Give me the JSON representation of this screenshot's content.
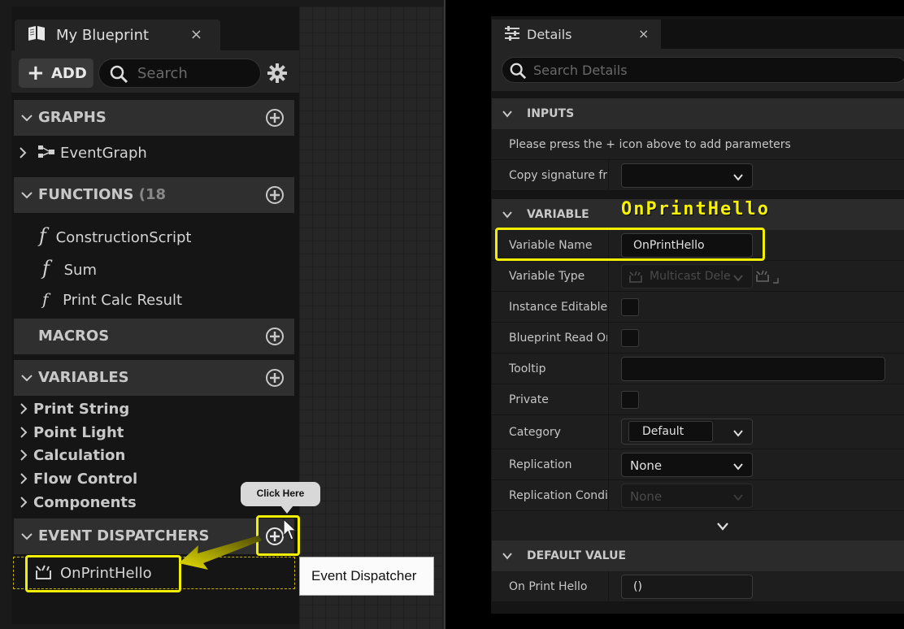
{
  "blueprint_panel": {
    "tab_title": "My Blueprint",
    "tab_close": "×",
    "add_label": "ADD",
    "search_placeholder": "Search",
    "sections": {
      "graphs": "GRAPHS",
      "functions": "FUNCTIONS",
      "functions_count": "(18",
      "macros": "MACROS",
      "variables": "VARIABLES",
      "event_dispatchers": "EVENT DISPATCHERS"
    },
    "graphs": [
      "EventGraph"
    ],
    "functions": [
      "ConstructionScript",
      "Sum",
      "Print Calc Result"
    ],
    "variable_categories": [
      "Print String",
      "Point Light",
      "Calculation",
      "Flow Control",
      "Components"
    ],
    "event_dispatchers": [
      "OnPrintHello"
    ],
    "tooltip_text": "Click Here",
    "callout_text": "Event Dispatcher"
  },
  "details_panel": {
    "tab_title": "Details",
    "tab_close": "×",
    "search_placeholder": "Search Details",
    "annotation": "OnPrintHello",
    "inputs": {
      "header": "INPUTS",
      "hint": "Please press the + icon above to add parameters",
      "copy_signature_label": "Copy signature fro"
    },
    "variable": {
      "header": "VARIABLE",
      "name_label": "Variable Name",
      "name_value": "OnPrintHello",
      "type_label": "Variable Type",
      "type_value": "Multicast Dele",
      "instance_editable_label": "Instance Editable",
      "bp_read_only_label": "Blueprint Read Onl",
      "tooltip_label": "Tooltip",
      "private_label": "Private",
      "category_label": "Category",
      "category_value": "Default",
      "replication_label": "Replication",
      "replication_value": "None",
      "replication_condition_label": "Replication Conditi",
      "replication_condition_value": "None"
    },
    "default_value": {
      "header": "DEFAULT VALUE",
      "on_print_hello_label": "On Print Hello",
      "on_print_hello_value": "()"
    }
  },
  "colors": {
    "highlight_yellow": "#f2ef00",
    "panel_bg": "#151515",
    "section_bg": "#2f2f2f"
  }
}
